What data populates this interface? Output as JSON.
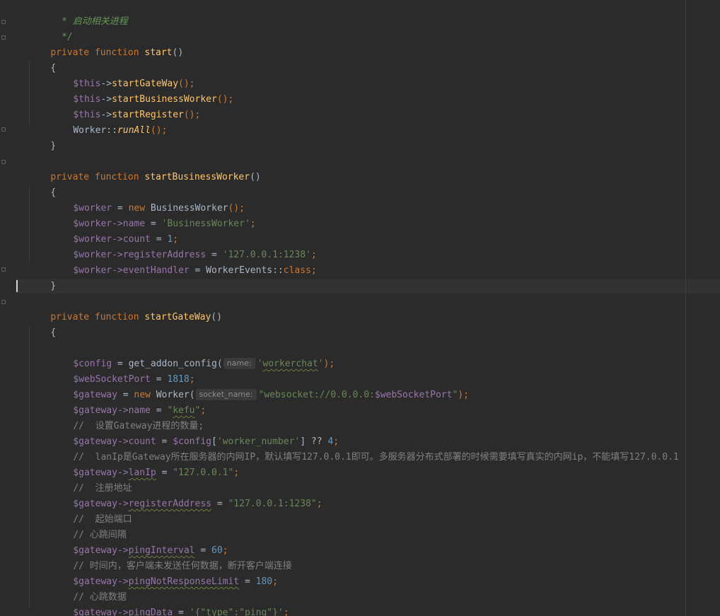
{
  "editor": {
    "language": "php",
    "colors": {
      "background": "#2b2b2b",
      "current_line": "#323232",
      "keyword": "#cc7832",
      "function": "#ffc66d",
      "variable": "#9876aa",
      "string": "#6a8759",
      "number": "#6897bb",
      "comment": "#808080",
      "doc_comment": "#629755",
      "text": "#a9b7c6"
    },
    "fold_icons": [
      "fold-open-icon",
      "fold-close-icon"
    ]
  },
  "code": {
    "l1": {
      "doc": " * 启动相关进程"
    },
    "l2": {
      "doc": " */"
    },
    "l3": {
      "kw": "private function ",
      "fn": "start",
      "rest": "()"
    },
    "l4": {
      "text": "{"
    },
    "l5": {
      "var": "$this",
      "op": "->",
      "fn": "startGateWay",
      "rest": "();"
    },
    "l6": {
      "var": "$this",
      "op": "->",
      "fn": "startBusinessWorker",
      "rest": "();"
    },
    "l7": {
      "var": "$this",
      "op": "->",
      "fn": "startRegister",
      "rest": "();"
    },
    "l8": {
      "cls": "Worker::",
      "fn": "runAll",
      "rest": "();"
    },
    "l9": {
      "text": "}"
    },
    "l10": {
      "kw": "private function ",
      "fn": "startBusinessWorker",
      "rest": "()"
    },
    "l11": {
      "text": "{"
    },
    "l12": {
      "var": "$worker",
      "op": " = ",
      "kw": "new ",
      "cls": "BusinessWorker",
      "rest": "();"
    },
    "l13": {
      "var": "$worker->name",
      "op": " = ",
      "str": "'BusinessWorker'",
      "rest": ";"
    },
    "l14": {
      "var": "$worker->count",
      "op": " = ",
      "num": "1",
      "rest": ";"
    },
    "l15": {
      "var": "$worker->registerAddress",
      "op": " = ",
      "str": "'127.0.0.1:1238'",
      "rest": ";"
    },
    "l16": {
      "var": "$worker->eventHandler",
      "op": " = ",
      "cls": "WorkerEvents::",
      "kw": "class",
      "rest": ";"
    },
    "l17": {
      "text": "}"
    },
    "l18": {
      "kw": "private function ",
      "fn": "startGateWay",
      "rest": "()"
    },
    "l19": {
      "text": "{"
    },
    "l20": {
      "var": "$config",
      "op": " = get_addon_config(",
      "hint": "name:",
      "str_a": "'",
      "str_b": "workerchat",
      "str_c": "'",
      "rest": ");"
    },
    "l21": {
      "var": "$webSocketPort",
      "op": " = ",
      "num": "1818",
      "rest": ";"
    },
    "l22": {
      "var": "$gateway",
      "op": " = ",
      "kw": "new ",
      "cls": "Worker(",
      "hint": "socket_name:",
      "str_a": "\"websocket://0.0.0.0:",
      "var2": "$webSocketPort",
      "str_c": "\"",
      "rest": ");"
    },
    "l23": {
      "var": "$gateway->name",
      "op": " = ",
      "str_a": "\"",
      "str_b": "kefu",
      "str_c": "\"",
      "rest": ";"
    },
    "l24": {
      "comment": "//  设置Gateway进程的数量;"
    },
    "l25": {
      "var": "$gateway->count",
      "op": " = ",
      "var2": "$config",
      "p1": "[",
      "str": "'worker_number'",
      "p2": "] ?? ",
      "num": "4",
      "rest": ";"
    },
    "l26": {
      "comment": "//  lanIp是Gateway所在服务器的内网IP，默认填写127.0.0.1即可。多服务器分布式部署的时候需要填写真实的内网ip，不能填写127.0.0.1"
    },
    "l27": {
      "var": "$gateway->",
      "var_sq": "lanIp",
      "op": " = ",
      "str": "\"127.0.0.1\"",
      "rest": ";"
    },
    "l28": {
      "comment": "//  注册地址"
    },
    "l29": {
      "var": "$gateway->",
      "var_sq": "registerAddress",
      "op": " = ",
      "str": "\"127.0.0.1:1238\"",
      "rest": ";"
    },
    "l30": {
      "comment": "//  起始端口"
    },
    "l31": {
      "comment": "// 心跳间隔"
    },
    "l32": {
      "var": "$gateway->",
      "var_sq": "pingInterval",
      "op": " = ",
      "num": "60",
      "rest": ";"
    },
    "l33": {
      "comment": "// 时间内，客户端未发送任何数据，断开客户端连接"
    },
    "l34": {
      "var": "$gateway->",
      "var_sq": "pingNotResponseLimit",
      "op": " = ",
      "num": "180",
      "rest": ";"
    },
    "l35": {
      "comment": "// 心跳数据"
    },
    "l36": {
      "var": "$gateway->",
      "var_sq": "pingData",
      "op": " = ",
      "str": "'{\"type\":\"ping\"}'",
      "rest": ";"
    },
    "l37": {
      "text": "}"
    }
  }
}
